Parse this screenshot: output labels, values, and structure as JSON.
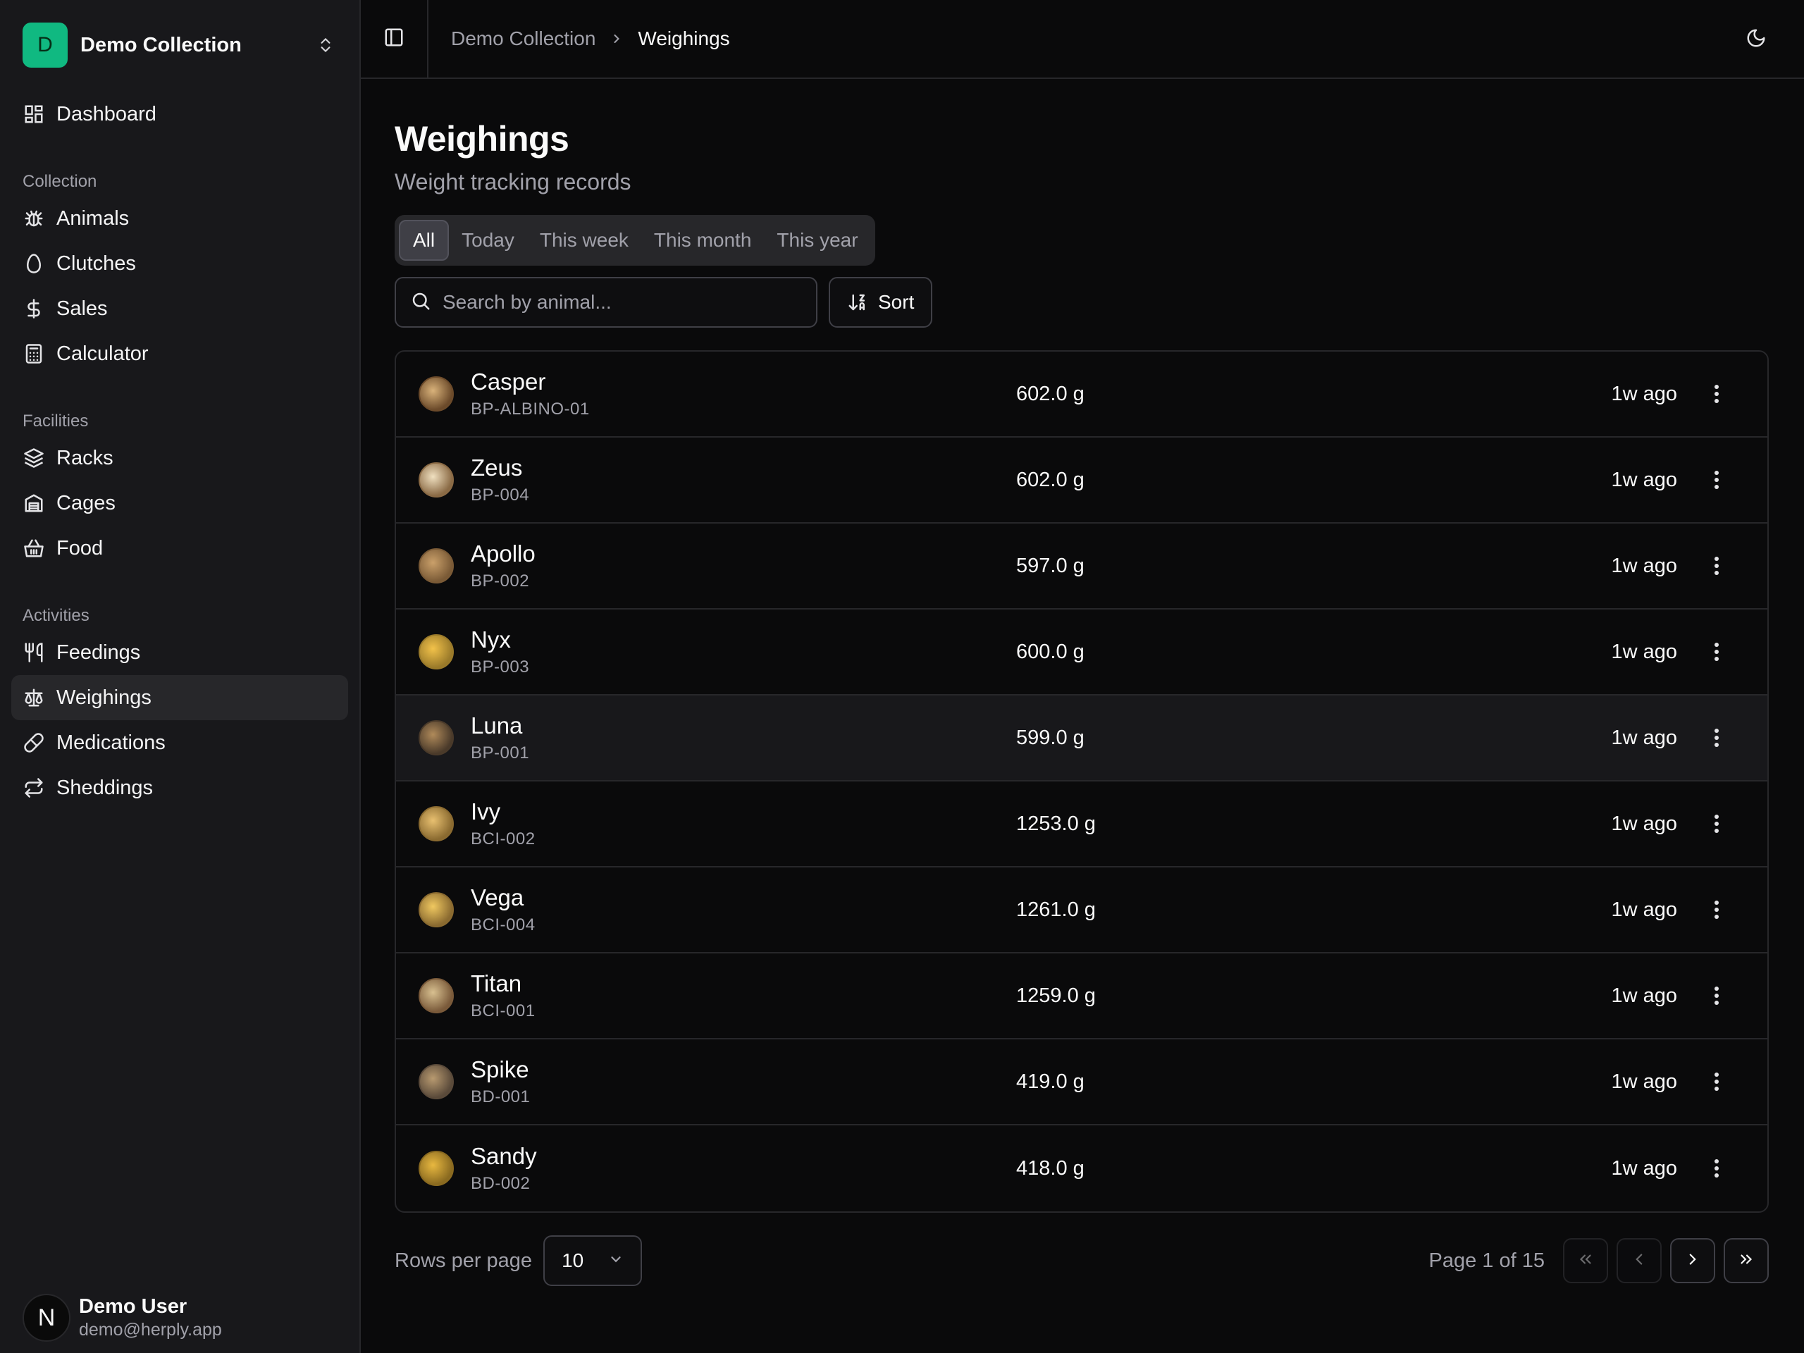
{
  "team": {
    "initial": "D",
    "name": "Demo Collection",
    "logo_color": "#10b981"
  },
  "nav": {
    "dashboard": "Dashboard",
    "groups": [
      {
        "label": "Collection",
        "items": [
          "Animals",
          "Clutches",
          "Sales",
          "Calculator"
        ]
      },
      {
        "label": "Facilities",
        "items": [
          "Racks",
          "Cages",
          "Food"
        ]
      },
      {
        "label": "Activities",
        "items": [
          "Feedings",
          "Weighings",
          "Medications",
          "Sheddings"
        ]
      }
    ],
    "active": "Weighings"
  },
  "user": {
    "initial": "N",
    "name": "Demo User",
    "email": "demo@herply.app"
  },
  "breadcrumb": {
    "root": "Demo Collection",
    "current": "Weighings"
  },
  "page": {
    "title": "Weighings",
    "subtitle": "Weight tracking records"
  },
  "tabs": [
    "All",
    "Today",
    "This week",
    "This month",
    "This year"
  ],
  "active_tab": "All",
  "search": {
    "placeholder": "Search by animal..."
  },
  "sort_label": "Sort",
  "rows": [
    {
      "name": "Casper",
      "code": "BP-ALBINO-01",
      "weight": "602.0 g",
      "when": "1w ago"
    },
    {
      "name": "Zeus",
      "code": "BP-004",
      "weight": "602.0 g",
      "when": "1w ago"
    },
    {
      "name": "Apollo",
      "code": "BP-002",
      "weight": "597.0 g",
      "when": "1w ago"
    },
    {
      "name": "Nyx",
      "code": "BP-003",
      "weight": "600.0 g",
      "when": "1w ago"
    },
    {
      "name": "Luna",
      "code": "BP-001",
      "weight": "599.0 g",
      "when": "1w ago"
    },
    {
      "name": "Ivy",
      "code": "BCI-002",
      "weight": "1253.0 g",
      "when": "1w ago"
    },
    {
      "name": "Vega",
      "code": "BCI-004",
      "weight": "1261.0 g",
      "when": "1w ago"
    },
    {
      "name": "Titan",
      "code": "BCI-001",
      "weight": "1259.0 g",
      "when": "1w ago"
    },
    {
      "name": "Spike",
      "code": "BD-001",
      "weight": "419.0 g",
      "when": "1w ago"
    },
    {
      "name": "Sandy",
      "code": "BD-002",
      "weight": "418.0 g",
      "when": "1w ago"
    }
  ],
  "pagination": {
    "rows_label": "Rows per page",
    "rows_value": "10",
    "page_info": "Page 1 of 15"
  },
  "colors": {
    "background": "#0a0a0b",
    "sidebar": "#18181b",
    "border": "#27272a",
    "muted_text": "#a1a1aa"
  }
}
